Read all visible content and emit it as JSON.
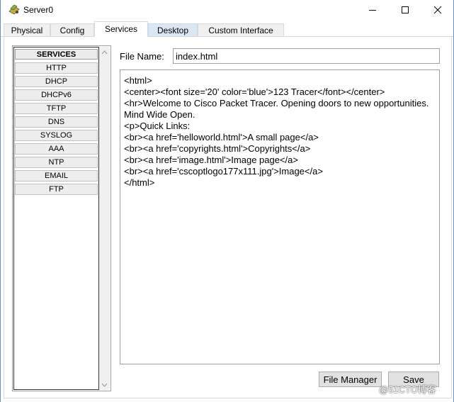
{
  "window": {
    "title": "Server0"
  },
  "tabs": [
    {
      "label": "Physical"
    },
    {
      "label": "Config"
    },
    {
      "label": "Services"
    },
    {
      "label": "Desktop"
    },
    {
      "label": "Custom Interface"
    }
  ],
  "services": {
    "header": "SERVICES",
    "items": [
      "HTTP",
      "DHCP",
      "DHCPv6",
      "TFTP",
      "DNS",
      "SYSLOG",
      "AAA",
      "NTP",
      "EMAIL",
      "FTP"
    ]
  },
  "file": {
    "label": "File Name:",
    "value": "index.html"
  },
  "editor": {
    "content": "<html>\n<center><font size='20' color='blue'>123 Tracer</font></center>\n<hr>Welcome to Cisco Packet Tracer. Opening doors to new opportunities. Mind Wide Open.\n<p>Quick Links:\n<br><a href='helloworld.html'>A small page</a>\n<br><a href='copyrights.html'>Copyrights</a>\n<br><a href='image.html'>Image page</a>\n<br><a href='cscoptlogo177x111.jpg'>Image</a>\n</html>"
  },
  "buttons": {
    "file_manager": "File Manager",
    "save": "Save"
  },
  "watermark": "@51CTO博客",
  "colors": {
    "tab_highlight": "#dbe7f5",
    "window_border": "#6a8fbf"
  }
}
